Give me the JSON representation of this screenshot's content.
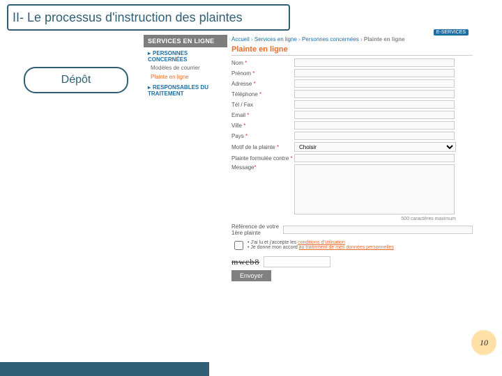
{
  "slide": {
    "title": "II- Le processus d'instruction des plaintes",
    "pill": "Dépôt",
    "page_number": "10"
  },
  "sidebar": {
    "header": "SERVICES EN LIGNE",
    "sections": [
      {
        "title": "PERSONNES CONCERNÉES",
        "items": [
          {
            "label": "Modèles de courrier",
            "active": false
          },
          {
            "label": "Plainte en ligne",
            "active": true
          }
        ]
      },
      {
        "title": "RESPONSABLES DU TRAITEMENT",
        "items": []
      }
    ]
  },
  "breadcrumb": {
    "parts": [
      "Accueil",
      "Services en ligne",
      "Personnes concernées",
      "Plainte en ligne"
    ],
    "sep": " › "
  },
  "badge": "E-SERVICES",
  "form": {
    "title": "Plainte en ligne",
    "fields": {
      "nom": "Nom",
      "prenom": "Prénom",
      "adresse": "Adresse",
      "telephone": "Téléphone",
      "fax": "Tél / Fax",
      "email": "Email",
      "ville": "Ville",
      "pays": "Pays",
      "motif": "Motif de la plainte",
      "contre": "Plainte formulée contre",
      "message": "Message",
      "ref": "Référence de votre 1ère plainte"
    },
    "select_placeholder": "Choisir",
    "max_note": "500 caractères maximum",
    "consent_prefix": "J'ai lu et j'accepte les ",
    "consent_link1": "conditions d'utilisation",
    "consent_mid": "Je donne mon accord ",
    "consent_link2": "au traitement de mes données personnelles",
    "captcha": "mwcb8",
    "submit": "Envoyer"
  }
}
